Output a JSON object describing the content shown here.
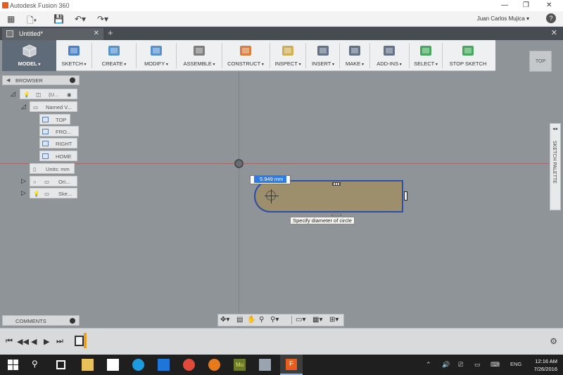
{
  "window": {
    "title": "Autodesk Fusion 360",
    "minimize": "—",
    "restore": "❐",
    "close": "✕"
  },
  "quick_access": {
    "user": "Juan Carlos Mujica ▾",
    "help": "?"
  },
  "doc_tab": {
    "name": "Untitled*",
    "close": "✕",
    "new_tab": "+"
  },
  "toolbar": {
    "model": "MODEL",
    "items": [
      {
        "label": "SKETCH",
        "icon": "sketch-icon",
        "color": "#2e6fc0"
      },
      {
        "label": "CREATE",
        "icon": "create-icon",
        "color": "#3b83c6"
      },
      {
        "label": "MODIFY",
        "icon": "modify-icon",
        "color": "#3b83c6"
      },
      {
        "label": "ASSEMBLE",
        "icon": "assemble-icon",
        "color": "#6a6a6a"
      },
      {
        "label": "CONSTRUCT",
        "icon": "construct-icon",
        "color": "#d46a1f"
      },
      {
        "label": "INSPECT",
        "icon": "inspect-icon",
        "color": "#c8a23a"
      },
      {
        "label": "INSERT",
        "icon": "insert-icon",
        "color": "#4a5c73"
      },
      {
        "label": "MAKE",
        "icon": "make-icon",
        "color": "#4a5c73"
      },
      {
        "label": "ADD-INS",
        "icon": "add-ins-icon",
        "color": "#4a5c73"
      },
      {
        "label": "SELECT",
        "icon": "select-icon",
        "color": "#2a9c44"
      },
      {
        "label": "STOP SKETCH",
        "icon": "stop-sketch-icon",
        "color": "#2a9c44"
      }
    ]
  },
  "viewcube": {
    "face": "TOP"
  },
  "browser": {
    "title": "BROWSER",
    "root": "(U...",
    "named_views": "Named V...",
    "views": [
      "TOP",
      "FRO...",
      "RIGHT",
      "HOME"
    ],
    "units": "Units: mm",
    "origin": "Ori...",
    "sketches": "Ske..."
  },
  "sketch_palette": {
    "label": "SKETCH PALETTE",
    "collapse": "◂◂"
  },
  "canvas": {
    "dimension_value": "5.949 mm",
    "tooltip": "Specify diameter of circle"
  },
  "comments": {
    "title": "COMMENTS"
  },
  "navbar": {
    "icons": [
      "orbit-icon",
      "pan-icon",
      "zoom-fit-icon",
      "zoom-window-icon",
      "display-icon",
      "grid-icon",
      "viewports-icon"
    ]
  },
  "timeline": {
    "controls": [
      "⏮",
      "◀◀",
      "◀",
      "▶",
      "⏭"
    ]
  },
  "taskbar": {
    "clock_time": "12:16 AM",
    "clock_date": "7/26/2016",
    "language": "ENG"
  }
}
